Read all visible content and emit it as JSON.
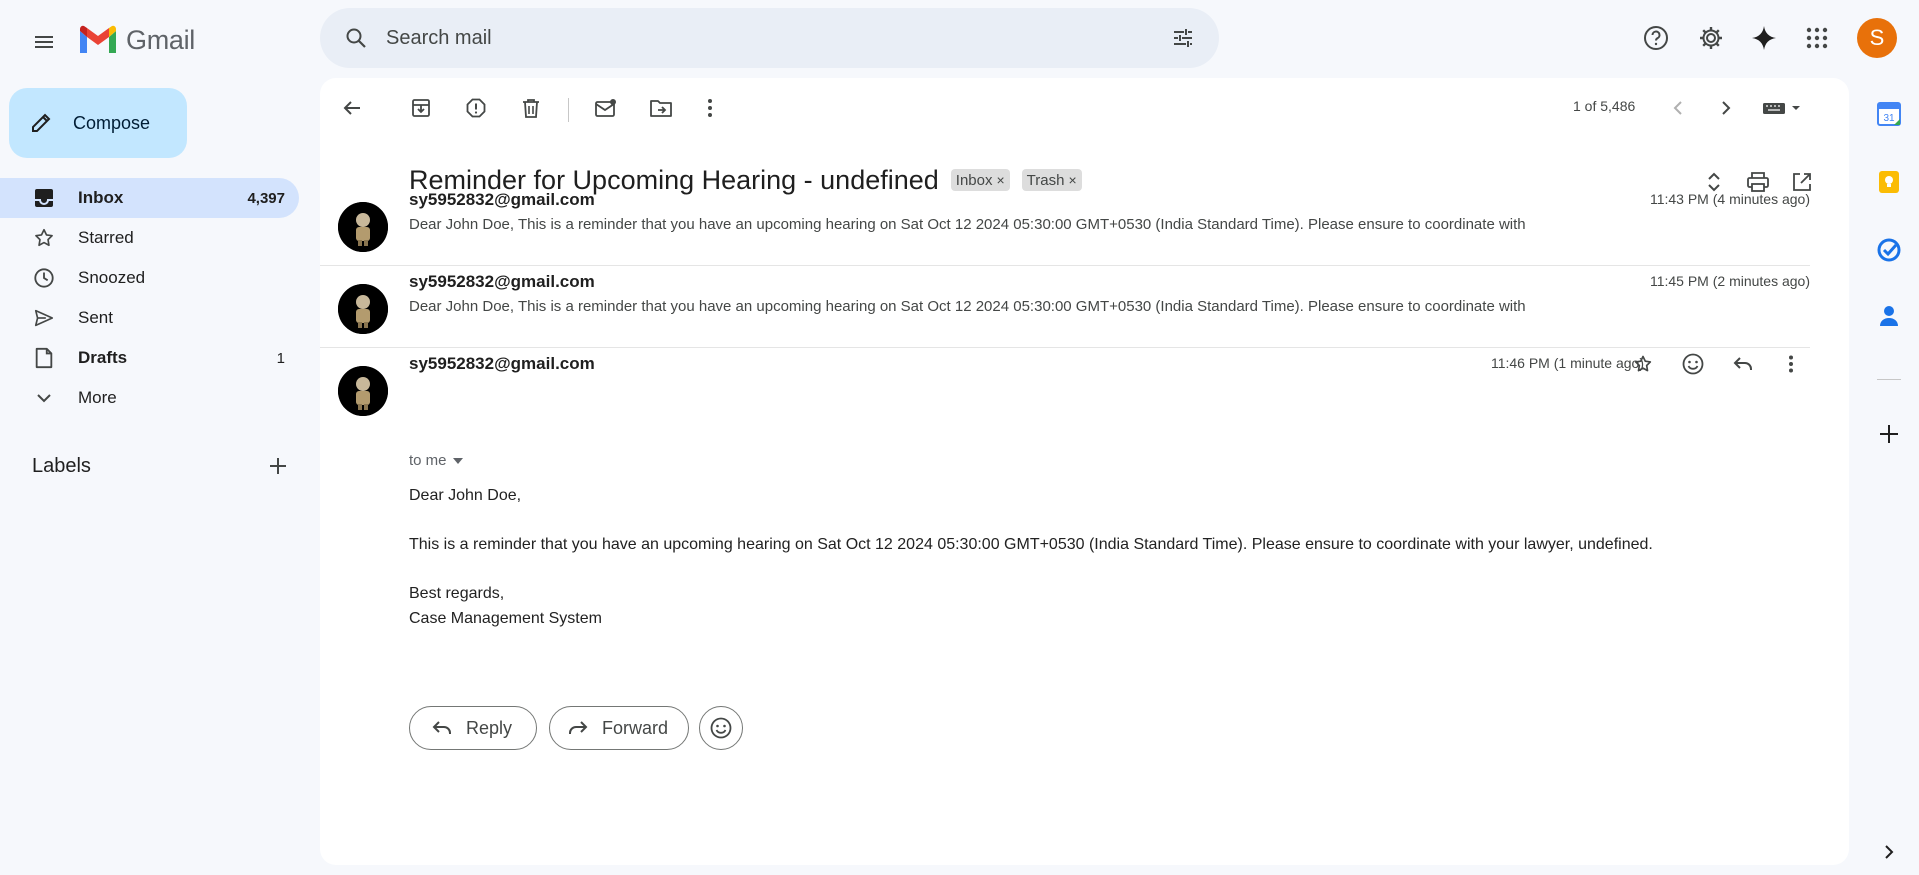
{
  "app": {
    "logo_text": "Gmail",
    "account_initial": "S"
  },
  "search": {
    "placeholder": "Search mail"
  },
  "compose": {
    "label": "Compose"
  },
  "nav": {
    "items": [
      {
        "label": "Inbox",
        "count": "4,397",
        "active": true,
        "icon": "inbox-icon"
      },
      {
        "label": "Starred",
        "count": "",
        "icon": "star-icon"
      },
      {
        "label": "Snoozed",
        "count": "",
        "icon": "clock-icon"
      },
      {
        "label": "Sent",
        "count": "",
        "icon": "send-icon"
      },
      {
        "label": "Drafts",
        "count": "1",
        "icon": "draft-icon"
      },
      {
        "label": "More",
        "count": "",
        "icon": "chevron-down-icon"
      }
    ]
  },
  "labels": {
    "title": "Labels"
  },
  "toolbar": {
    "pager": "1 of 5,486"
  },
  "thread": {
    "subject": "Reminder for Upcoming Hearing - undefined",
    "chips": [
      "Inbox",
      "Trash"
    ],
    "messages": [
      {
        "sender": "sy5952832@gmail.com",
        "time": "11:43 PM (4 minutes ago)",
        "snippet": "Dear John Doe, This is a reminder that you have an upcoming hearing on Sat Oct 12 2024 05:30:00 GMT+0530 (India Standard Time). Please ensure to coordinate with"
      },
      {
        "sender": "sy5952832@gmail.com",
        "time": "11:45 PM (2 minutes ago)",
        "snippet": "Dear John Doe, This is a reminder that you have an upcoming hearing on Sat Oct 12 2024 05:30:00 GMT+0530 (India Standard Time). Please ensure to coordinate with"
      },
      {
        "sender": "sy5952832@gmail.com",
        "time": "11:46 PM (1 minute ago)",
        "to": "to me",
        "body": [
          "Dear John Doe,",
          "This is a reminder that you have an upcoming hearing on Sat Oct 12 2024 05:30:00 GMT+0530 (India Standard Time). Please ensure to coordinate with your lawyer, undefined.",
          "Best regards,",
          "Case Management System"
        ]
      }
    ]
  },
  "actions": {
    "reply": "Reply",
    "forward": "Forward"
  },
  "side_panel": {
    "calendar_day": "31"
  },
  "colors": {
    "accent": "#0b57d0",
    "compose_bg": "#c2e7ff",
    "active_nav": "#d3e3fd",
    "avatar": "#e8710a"
  }
}
